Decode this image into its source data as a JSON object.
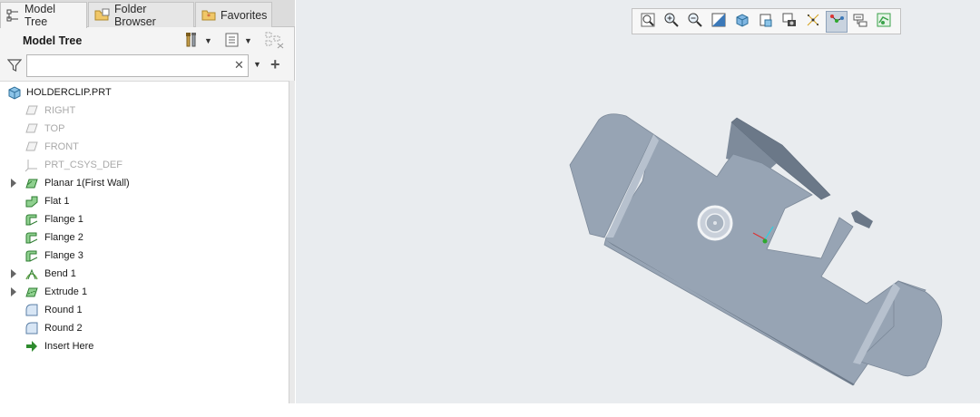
{
  "tabs": [
    {
      "label": "Model Tree",
      "icon": "model-tree-icon",
      "active": true
    },
    {
      "label": "Folder Browser",
      "icon": "folder-browser-icon",
      "active": false
    },
    {
      "label": "Favorites",
      "icon": "favorites-icon",
      "active": false
    }
  ],
  "panel": {
    "title": "Model Tree",
    "filter_value": "",
    "filter_placeholder": ""
  },
  "tree": {
    "root": "HOLDERCLIP.PRT",
    "items": [
      {
        "label": "RIGHT",
        "icon": "datum-plane-icon",
        "dim": true,
        "expandable": false
      },
      {
        "label": "TOP",
        "icon": "datum-plane-icon",
        "dim": true,
        "expandable": false
      },
      {
        "label": "FRONT",
        "icon": "datum-plane-icon",
        "dim": true,
        "expandable": false
      },
      {
        "label": "PRT_CSYS_DEF",
        "icon": "csys-icon",
        "dim": true,
        "expandable": false
      },
      {
        "label": "Planar 1(First Wall)",
        "icon": "planar-wall-icon",
        "dim": false,
        "expandable": true
      },
      {
        "label": "Flat 1",
        "icon": "flat-wall-icon",
        "dim": false,
        "expandable": false
      },
      {
        "label": "Flange 1",
        "icon": "flange-icon",
        "dim": false,
        "expandable": false
      },
      {
        "label": "Flange 2",
        "icon": "flange-icon",
        "dim": false,
        "expandable": false
      },
      {
        "label": "Flange 3",
        "icon": "flange-icon",
        "dim": false,
        "expandable": false
      },
      {
        "label": "Bend 1",
        "icon": "bend-icon",
        "dim": false,
        "expandable": true
      },
      {
        "label": "Extrude 1",
        "icon": "extrude-icon",
        "dim": false,
        "expandable": true
      },
      {
        "label": "Round 1",
        "icon": "round-icon",
        "dim": false,
        "expandable": false
      },
      {
        "label": "Round 2",
        "icon": "round-icon",
        "dim": false,
        "expandable": false
      },
      {
        "label": "Insert Here",
        "icon": "insert-arrow-icon",
        "dim": false,
        "expandable": false
      }
    ]
  },
  "view_toolbar": [
    {
      "name": "refit-icon",
      "active": false
    },
    {
      "name": "zoom-in-icon",
      "active": false
    },
    {
      "name": "zoom-out-icon",
      "active": false
    },
    {
      "name": "repaint-icon",
      "active": false
    },
    {
      "name": "display-style-icon",
      "active": false
    },
    {
      "name": "saved-orientations-icon",
      "active": false
    },
    {
      "name": "view-manager-icon",
      "active": false
    },
    {
      "name": "datum-display-icon",
      "active": false
    },
    {
      "name": "spin-center-icon",
      "active": true
    },
    {
      "name": "annotation-display-icon",
      "active": false
    },
    {
      "name": "sheetmetal-display-icon",
      "active": false
    }
  ],
  "colors": {
    "viewport_bg": "#e9ecef",
    "model_face": "#97a4b4",
    "model_dark": "#6b7888",
    "model_light": "#b7c1ce",
    "active_tool": "#c9d3df",
    "insert_arrow": "#2e8b2e",
    "sheetmetal_green": "#3aa24a"
  }
}
